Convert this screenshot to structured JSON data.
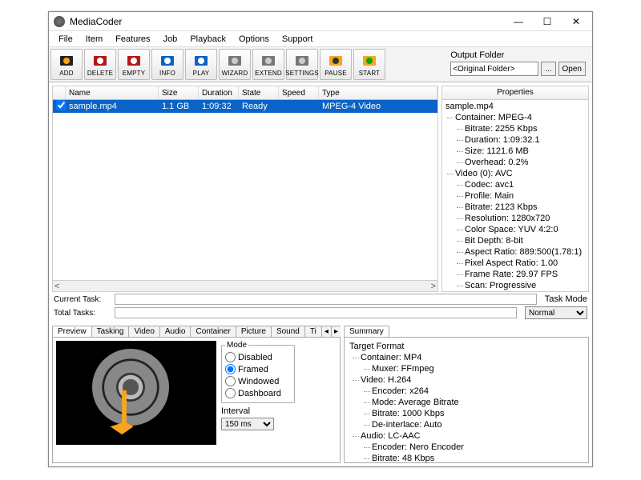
{
  "window": {
    "title": "MediaCoder"
  },
  "win_controls": {
    "min": "—",
    "max": "☐",
    "close": "✕"
  },
  "menu": [
    "File",
    "Item",
    "Features",
    "Job",
    "Playback",
    "Options",
    "Support"
  ],
  "toolbar": [
    {
      "id": "add",
      "label": "ADD",
      "fill": "#222",
      "sub": "#f6a61e"
    },
    {
      "id": "delete",
      "label": "DELETE",
      "fill": "#b31818",
      "sub": "#fff"
    },
    {
      "id": "empty",
      "label": "EMPTY",
      "fill": "#b31818",
      "sub": "#fff"
    },
    {
      "id": "info",
      "label": "INFO",
      "fill": "#0a63c6",
      "sub": "#fff"
    },
    {
      "id": "play",
      "label": "PLAY",
      "fill": "#0a63c6",
      "sub": "#fff"
    },
    {
      "id": "wizard",
      "label": "WIZARD",
      "fill": "#777",
      "sub": "#ccc"
    },
    {
      "id": "extend",
      "label": "EXTEND",
      "fill": "#777",
      "sub": "#ccc"
    },
    {
      "id": "settings",
      "label": "SETTINGS",
      "fill": "#777",
      "sub": "#ccc"
    },
    {
      "id": "pause",
      "label": "PAUSE",
      "fill": "#f6a61e",
      "sub": "#333"
    },
    {
      "id": "start",
      "label": "START",
      "fill": "#f6a61e",
      "sub": "#0a0"
    }
  ],
  "output_folder": {
    "label": "Output Folder",
    "value": "<Original Folder>",
    "browse": "...",
    "open": "Open"
  },
  "file_list": {
    "columns": {
      "name": "Name",
      "size": "Size",
      "duration": "Duration",
      "state": "State",
      "speed": "Speed",
      "type": "Type"
    },
    "rows": [
      {
        "checked": true,
        "name": "sample.mp4",
        "size": "1.1 GB",
        "duration": "1:09:32",
        "state": "Ready",
        "speed": "",
        "type": "MPEG-4 Video"
      }
    ],
    "hscroll": {
      "left": "<",
      "right": ">"
    }
  },
  "properties": {
    "title": "Properties",
    "lines": [
      {
        "lvl": 0,
        "text": "sample.mp4"
      },
      {
        "lvl": 1,
        "text": "Container: MPEG-4"
      },
      {
        "lvl": 2,
        "text": "Bitrate: 2255 Kbps"
      },
      {
        "lvl": 2,
        "text": "Duration: 1:09:32.1"
      },
      {
        "lvl": 2,
        "text": "Size: 1121.6 MB"
      },
      {
        "lvl": 2,
        "text": "Overhead: 0.2%"
      },
      {
        "lvl": 1,
        "text": "Video (0): AVC"
      },
      {
        "lvl": 2,
        "text": "Codec: avc1"
      },
      {
        "lvl": 2,
        "text": "Profile: Main"
      },
      {
        "lvl": 2,
        "text": "Bitrate: 2123 Kbps"
      },
      {
        "lvl": 2,
        "text": "Resolution: 1280x720"
      },
      {
        "lvl": 2,
        "text": "Color Space: YUV 4:2:0"
      },
      {
        "lvl": 2,
        "text": "Bit Depth: 8-bit"
      },
      {
        "lvl": 2,
        "text": "Aspect Ratio: 889:500(1.78:1)"
      },
      {
        "lvl": 2,
        "text": "Pixel Aspect Ratio: 1.00"
      },
      {
        "lvl": 2,
        "text": "Frame Rate: 29.97 FPS"
      },
      {
        "lvl": 2,
        "text": "Scan: Progressive"
      }
    ]
  },
  "tasks": {
    "current_label": "Current Task:",
    "total_label": "Total Tasks:",
    "mode_label": "Task Mode",
    "mode_value": "Normal"
  },
  "left_tabs": [
    "Preview",
    "Tasking",
    "Video",
    "Audio",
    "Container",
    "Picture",
    "Sound",
    "Ti"
  ],
  "tab_nav": {
    "prev": "◂",
    "next": "▸"
  },
  "right_tabs": [
    "Summary"
  ],
  "preview": {
    "mode_label": "Mode",
    "modes": [
      {
        "id": "disabled",
        "label": "Disabled",
        "sel": false
      },
      {
        "id": "framed",
        "label": "Framed",
        "sel": true
      },
      {
        "id": "windowed",
        "label": "Windowed",
        "sel": false
      },
      {
        "id": "dashboard",
        "label": "Dashboard",
        "sel": false
      }
    ],
    "interval_label": "Interval",
    "interval_value": "150 ms"
  },
  "summary": {
    "lines": [
      {
        "lvl": 0,
        "text": "Target Format"
      },
      {
        "lvl": 1,
        "text": "Container: MP4"
      },
      {
        "lvl": 2,
        "text": "Muxer: FFmpeg"
      },
      {
        "lvl": 1,
        "text": "Video: H.264"
      },
      {
        "lvl": 2,
        "text": "Encoder: x264"
      },
      {
        "lvl": 2,
        "text": "Mode: Average Bitrate"
      },
      {
        "lvl": 2,
        "text": "Bitrate: 1000 Kbps"
      },
      {
        "lvl": 2,
        "text": "De-interlace: Auto"
      },
      {
        "lvl": 1,
        "text": "Audio: LC-AAC"
      },
      {
        "lvl": 2,
        "text": "Encoder: Nero Encoder"
      },
      {
        "lvl": 2,
        "text": "Bitrate: 48 Kbps"
      }
    ]
  }
}
